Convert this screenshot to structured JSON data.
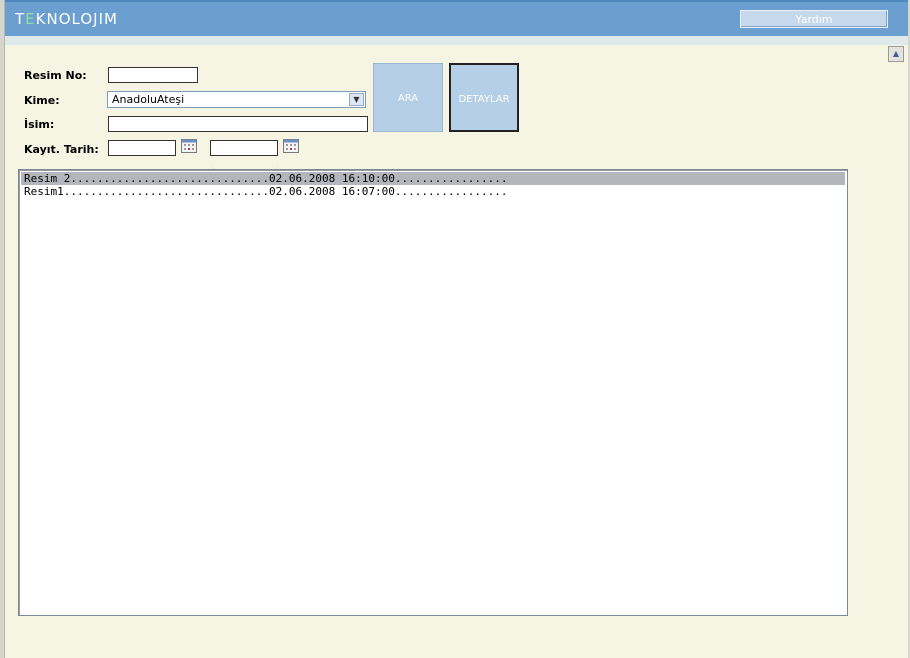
{
  "header": {
    "logo_parts": [
      "T",
      "E",
      "KNOLOJIM"
    ],
    "help_label": "Yardım"
  },
  "form": {
    "resim_no_label": "Resim No:",
    "resim_no_value": "",
    "kime_label": "Kime:",
    "kime_selected": "AnadoluAteşi",
    "isim_label": "İsim:",
    "isim_value": "",
    "tarih_label": "Kayıt. Tarih:",
    "tarih_start": "",
    "tarih_end": ""
  },
  "buttons": {
    "ara_label": "ARA",
    "detaylar_label": "DETAYLAR"
  },
  "list": {
    "rows": [
      "Resim 2..............................02.06.2008 16:10:00.................",
      "Resim1...............................02.06.2008 16:07:00................."
    ],
    "selected_index": 0
  },
  "colors": {
    "topbar": "#6a9fcf",
    "background": "#f6f5e4",
    "button_fill": "#b4cfe6",
    "selection": "#b5b5bd"
  },
  "icons": {
    "calendar": "calendar-icon",
    "dropdown": "chevron-down-icon",
    "scroll": "scroll-up-icon"
  }
}
